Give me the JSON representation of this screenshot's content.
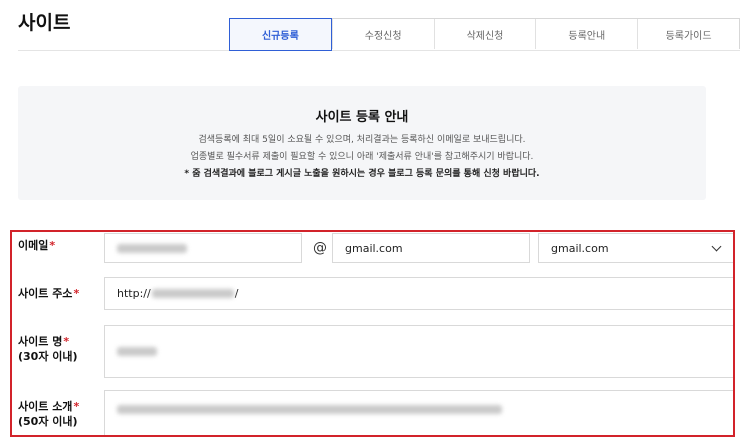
{
  "header": {
    "title": "사이트"
  },
  "tabs": [
    {
      "label": "신규등록",
      "active": true
    },
    {
      "label": "수정신청",
      "active": false
    },
    {
      "label": "삭제신청",
      "active": false
    },
    {
      "label": "등록안내",
      "active": false
    },
    {
      "label": "등록가이드",
      "active": false
    }
  ],
  "notice": {
    "title": "사이트 등록 안내",
    "lines": [
      "검색등록에 최대 5일이 소요될 수 있으며, 처리결과는 등록하신 이메일로 보내드립니다.",
      "업종별로 필수서류 제출이 필요할 수 있으니 아래 '제출서류 안내'를 참고해주시기 바랍니다.",
      "* 줌 검색결과에 블로그 게시글 노출을 원하시는 경우 블로그 등록 문의를 통해 신청 바랍니다."
    ]
  },
  "form": {
    "required_mark": "*",
    "email": {
      "label": "이메일",
      "at": "@",
      "domain_value": "gmail.com",
      "domain_select": "gmail.com"
    },
    "site_url": {
      "label": "사이트 주소",
      "prefix": "http://",
      "suffix": "/"
    },
    "site_name": {
      "label": "사이트 명",
      "sublabel": "(30자 이내)"
    },
    "site_desc": {
      "label": "사이트 소개",
      "sublabel": "(50자 이내)"
    }
  },
  "colors": {
    "accent": "#2f5fd6",
    "required": "#d2232a",
    "highlight_border": "#d2232a"
  }
}
